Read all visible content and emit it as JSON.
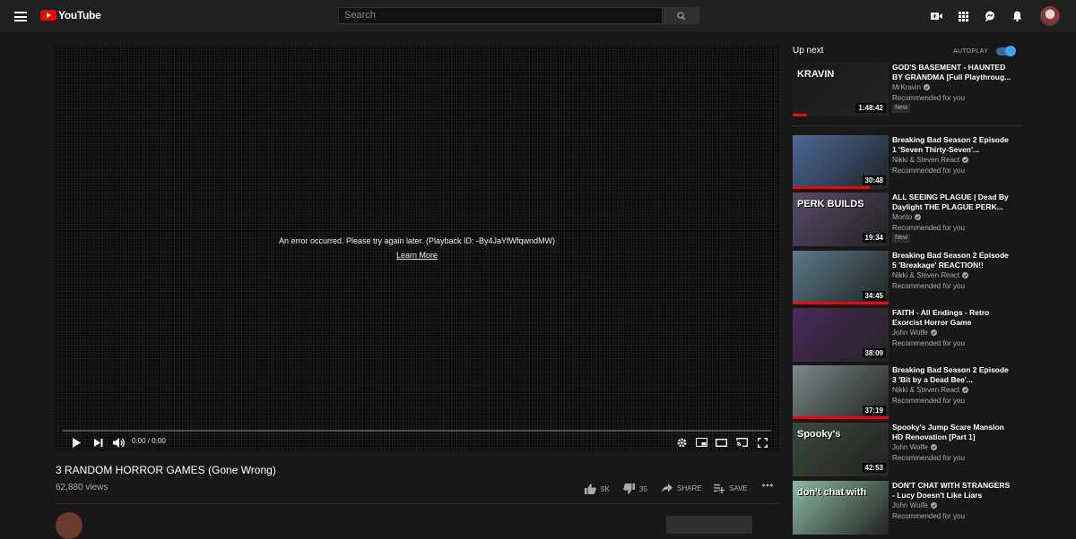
{
  "topbar": {
    "logo_text": "YouTube",
    "search_placeholder": "Search",
    "icons": [
      "menu-icon",
      "search-icon",
      "video-camera-icon",
      "apps-grid-icon",
      "messages-icon",
      "bell-icon",
      "avatar"
    ]
  },
  "player": {
    "error_message": "An error occurred. Please try again later. (Playback ID: -By4JaYfWfqwndMW)",
    "learn_more": "Learn More",
    "time": "0:00 / 0:00"
  },
  "video": {
    "title": "3 RANDOM HORROR GAMES (Gone Wrong)",
    "views": "62,880 views",
    "likes": "5K",
    "dislikes": "35",
    "share": "SHARE",
    "save": "SAVE"
  },
  "sidebar": {
    "up_next": "Up next",
    "autoplay": "AUTOPLAY",
    "autoplay_on": true,
    "recommended": [
      {
        "title": "GOD'S BASEMENT - HAUNTED BY GRANDMA [Full Playthroug...",
        "channel": "MrKravin",
        "sub": "Recommended for you",
        "badge": "New",
        "duration": "1:48:42",
        "thumb_text": "KRAVIN",
        "thumb_color": "#1a1a1a",
        "progress": 0.15
      },
      {
        "title": "Breaking Bad Season 2 Episode 1 'Seven Thirty-Seven'...",
        "channel": "Nikki & Steven React",
        "sub": "Recommended for you",
        "badge": "",
        "duration": "30:48",
        "thumb_text": "",
        "thumb_color": "#4a6a9a",
        "progress": 0.8
      },
      {
        "title": "ALL SEEING PLAGUE | Dead By Daylight THE PLAGUE PERK...",
        "channel": "Monto",
        "sub": "Recommended for you",
        "badge": "New",
        "duration": "19:34",
        "thumb_text": "PERK BUILDS",
        "thumb_color": "#5a4a6a",
        "progress": 0
      },
      {
        "title": "Breaking Bad Season 2 Episode 5 'Breakage' REACTION!!",
        "channel": "Nikki & Steven React",
        "sub": "Recommended for you",
        "badge": "",
        "duration": "34:45",
        "thumb_text": "",
        "thumb_color": "#5a7a8a",
        "progress": 1.0
      },
      {
        "title": "FAITH - All Endings - Retro Exorcist Horror Game",
        "channel": "John Wolfe",
        "sub": "Recommended for you",
        "badge": "",
        "duration": "38:09",
        "thumb_text": "",
        "thumb_color": "#4a2a5a",
        "progress": 0
      },
      {
        "title": "Breaking Bad Season 2 Episode 3 'Bit by a Dead Bee'...",
        "channel": "Nikki & Steven React",
        "sub": "Recommended for you",
        "badge": "",
        "duration": "37:19",
        "thumb_text": "",
        "thumb_color": "#7a8a8a",
        "progress": 1.0
      },
      {
        "title": "Spooky's Jump Scare Mansion HD Renovation [Part 1]",
        "channel": "John Wolfe",
        "sub": "Recommended for you",
        "badge": "",
        "duration": "42:53",
        "thumb_text": "Spooky's",
        "thumb_color": "#3a4a3a",
        "progress": 0
      },
      {
        "title": "DON'T CHAT WITH STRANGERS - Lucy Doesn't Like Liars",
        "channel": "John Wolfe",
        "sub": "Recommended for you",
        "badge": "",
        "duration": "",
        "thumb_text": "don't chat with",
        "thumb_color": "#8abaa0",
        "progress": 0
      }
    ]
  }
}
